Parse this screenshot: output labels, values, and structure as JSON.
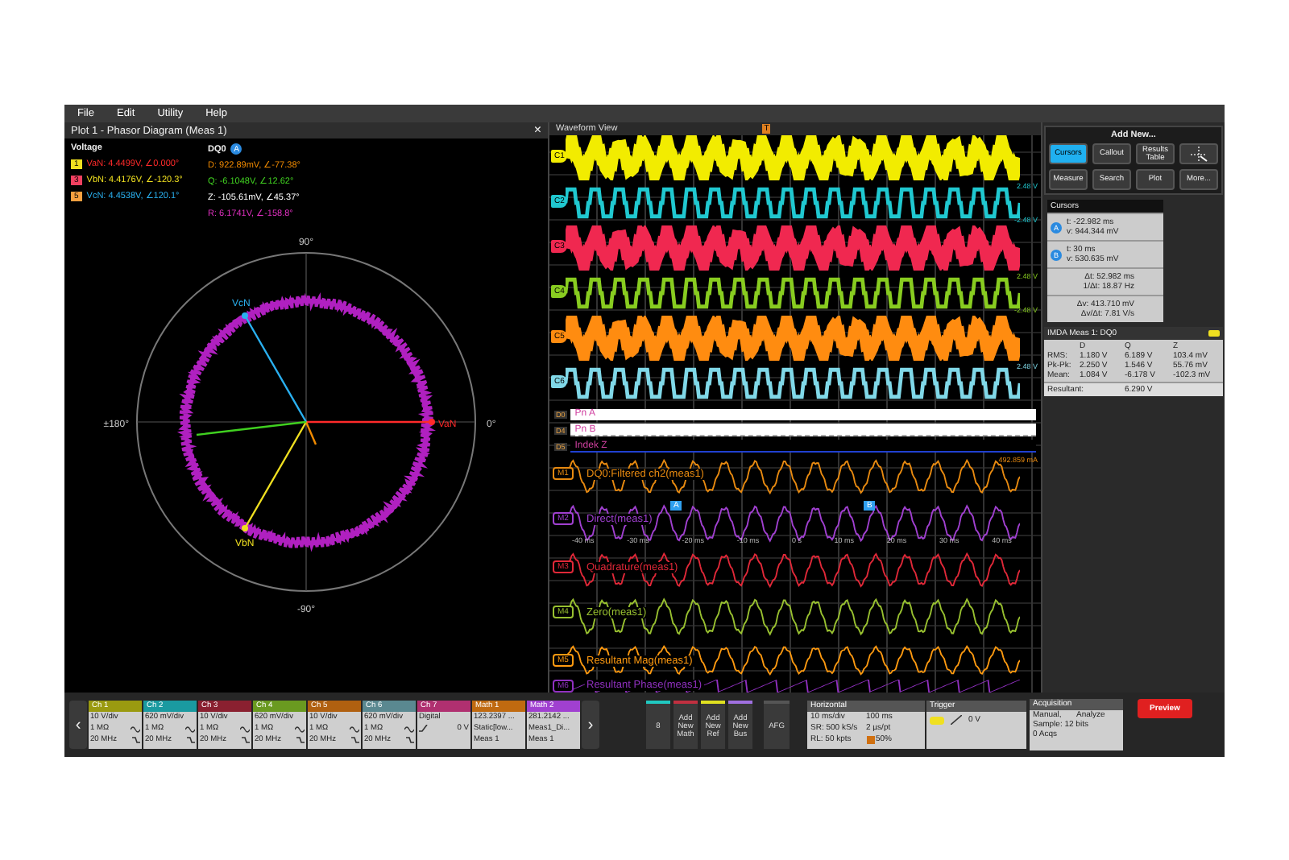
{
  "menu": [
    "File",
    "Edit",
    "Utility",
    "Help"
  ],
  "phasor": {
    "title": "Plot 1 - Phasor Diagram (Meas 1)",
    "close": "×",
    "voltage_heading": "Voltage",
    "dq0_heading": "DQ0",
    "dq0_badge": "A",
    "voltages": [
      {
        "badge": {
          "label": "1",
          "color": "#f0e020"
        },
        "text": "VaN: 4.4499V, ∠0.000°",
        "color": "#ff2a2a",
        "vector": "VaN"
      },
      {
        "badge": {
          "label": "3",
          "color": "#f04060"
        },
        "text": "VbN: 4.4176V, ∠-120.3°",
        "color": "#f0e020",
        "vector": "VbN"
      },
      {
        "badge": {
          "label": "5",
          "color": "#f7a040"
        },
        "text": "VcN: 4.4538V, ∠120.1°",
        "color": "#2ab0f0",
        "vector": "VcN"
      }
    ],
    "dq0": [
      {
        "text": "D: 922.89mV, ∠-77.38°",
        "color": "#f08a00"
      },
      {
        "text": "Q: -6.1048V, ∠12.62°",
        "color": "#40d020"
      },
      {
        "text": "Z: -105.61mV, ∠45.37°",
        "color": "#ffffff"
      },
      {
        "text": "R: 6.1741V, ∠-158.8°",
        "color": "#e030c0"
      }
    ],
    "axis_labels": [
      "90°",
      "0°",
      "±180°",
      "-90°"
    ]
  },
  "waveform": {
    "title": "Waveform View",
    "trigger": "T",
    "analog": [
      {
        "badge": "C1",
        "color": "#f2ec00",
        "kind": "pwm"
      },
      {
        "badge": "C2",
        "color": "#20c8d0",
        "kind": "step",
        "scale_top": "2.48 V",
        "scale_bottom": "-2.48 V"
      },
      {
        "badge": "C3",
        "color": "#f02850",
        "kind": "pwm"
      },
      {
        "badge": "C4",
        "color": "#88cc20",
        "kind": "step",
        "scale_top": "2.48 V",
        "scale_bottom": "-2.48 V"
      },
      {
        "badge": "C5",
        "color": "#ff8c10",
        "kind": "pwm"
      },
      {
        "badge": "C6",
        "color": "#80d8e8",
        "kind": "step",
        "scale_top": "2.48 V"
      }
    ],
    "digital": [
      {
        "badge": "D0",
        "label": "Pn A",
        "kind": "high"
      },
      {
        "badge": "D4",
        "label": "Pn B",
        "kind": "dashed"
      },
      {
        "badge": "D5",
        "label": "Indek Z",
        "kind": "ticks"
      }
    ],
    "math": [
      {
        "badge": "M1",
        "label": "DQ0:Filtered ch2(meas1)",
        "color": "#e88a10",
        "kind": "sine",
        "scale_top": "492.859 mA"
      },
      {
        "badge": "M2",
        "label": "Direct(meas1)",
        "color": "#a040d0",
        "kind": "sine",
        "cursors": [
          "A",
          "B"
        ],
        "time_ticks": [
          "-40 ms",
          "-30 ms",
          "-20 ms",
          "-10 ms",
          "0 s",
          "10 ms",
          "20 ms",
          "30 ms",
          "40 ms"
        ]
      },
      {
        "badge": "M3",
        "label": "Quadrature(meas1)",
        "color": "#e02838",
        "kind": "sine"
      },
      {
        "badge": "M4",
        "label": "Zero(meas1)",
        "color": "#98c030",
        "kind": "sine"
      },
      {
        "badge": "M5",
        "label": "Resultant Mag(meas1)",
        "color": "#ff9a10",
        "kind": "sine"
      },
      {
        "badge": "M6",
        "label": "Resultant Phase(meas1)",
        "color": "#9030c0",
        "kind": "saw"
      }
    ]
  },
  "add_new": {
    "title": "Add New...",
    "buttons": [
      {
        "kind": "text",
        "label": "Cursors",
        "selected": true
      },
      {
        "kind": "text",
        "label": "Callout",
        "selected": false
      },
      {
        "kind": "text",
        "label": "Results Table",
        "selected": false
      },
      {
        "kind": "icon",
        "selected": false
      },
      {
        "kind": "text",
        "label": "Measure",
        "selected": false
      },
      {
        "kind": "text",
        "label": "Search",
        "selected": false
      },
      {
        "kind": "text",
        "label": "Plot",
        "selected": false
      },
      {
        "kind": "text",
        "label": "More...",
        "selected": false
      }
    ]
  },
  "cursors": {
    "title": "Cursors",
    "groups": [
      {
        "marker": "A",
        "lines": [
          "t: -22.982 ms",
          "v: 944.344 mV"
        ]
      },
      {
        "marker": "B",
        "lines": [
          "t: 30 ms",
          "v: 530.635 mV"
        ]
      },
      {
        "lines": [
          "Δt: 52.982 ms",
          "1/Δt: 18.87 Hz"
        ]
      },
      {
        "lines": [
          "Δv: 413.710 mV",
          "Δv/Δt: 7.81 V/s"
        ]
      }
    ]
  },
  "measurement": {
    "title": "IMDA Meas 1: DQ0",
    "columns": [
      "D",
      "Q",
      "Z"
    ],
    "rows": [
      {
        "label": "RMS:",
        "values": [
          "1.180 V",
          "6.189 V",
          "103.4 mV"
        ]
      },
      {
        "label": "Pk-Pk:",
        "values": [
          "2.250 V",
          "1.546 V",
          "55.76 mV"
        ]
      },
      {
        "label": "Mean:",
        "values": [
          "1.084 V",
          "-6.178 V",
          "-102.3 mV"
        ]
      }
    ],
    "resultant": [
      "Resultant:",
      "6.290 V"
    ]
  },
  "channels": [
    {
      "name": "Ch 1",
      "color": "#9a9a10",
      "kind": "analog",
      "lines": [
        "10 V/div",
        "1 MΩ",
        "20 MHz"
      ]
    },
    {
      "name": "Ch 2",
      "color": "#1a9aa0",
      "kind": "analog",
      "lines": [
        "620 mV/div",
        "1 MΩ",
        "20 MHz"
      ]
    },
    {
      "name": "Ch 3",
      "color": "#8a2030",
      "kind": "analog",
      "lines": [
        "10 V/div",
        "1 MΩ",
        "20 MHz"
      ]
    },
    {
      "name": "Ch 4",
      "color": "#6a9a20",
      "kind": "analog",
      "lines": [
        "620 mV/div",
        "1 MΩ",
        "20 MHz"
      ]
    },
    {
      "name": "Ch 5",
      "color": "#b06010",
      "kind": "analog",
      "lines": [
        "10 V/div",
        "1 MΩ",
        "20 MHz"
      ]
    },
    {
      "name": "Ch 6",
      "color": "#5a8890",
      "kind": "analog",
      "lines": [
        "620 mV/div",
        "1 MΩ",
        "20 MHz"
      ]
    },
    {
      "name": "Ch 7",
      "color": "#b03070",
      "kind": "digital",
      "lines": [
        "Digital",
        "0 V"
      ]
    },
    {
      "name": "Math 1",
      "color": "#c06a10",
      "kind": "math",
      "lines": [
        "123.2397 ...",
        "Static[low...",
        "Meas 1"
      ]
    },
    {
      "name": "Math 2",
      "color": "#a040d0",
      "kind": "math",
      "lines": [
        "281.2142 ...",
        "Meas1_Di...",
        "Meas 1"
      ]
    }
  ],
  "nav": {
    "prev": "‹",
    "next": "›"
  },
  "tools": [
    {
      "label": "8",
      "color": "#20c8c0"
    },
    {
      "label": "Add New Math",
      "color": "#c03040"
    },
    {
      "label": "Add New Ref",
      "color": "#e0e020"
    },
    {
      "label": "Add New Bus",
      "color": "#a070e0"
    },
    {
      "label": "AFG",
      "color": "#555555"
    }
  ],
  "horizontal": {
    "title": "Horizontal",
    "cells": [
      "10 ms/div",
      "100 ms",
      "SR: 500 kS/s",
      "2 µs/pt",
      "RL: 50 kpts",
      "50%"
    ]
  },
  "trigger": {
    "title": "Trigger",
    "source": {
      "color": "#f0e020"
    },
    "value": "0 V"
  },
  "acquisition": {
    "title": "Acquisition",
    "cells": [
      "Manual,",
      "Analyze"
    ],
    "sample": "Sample: 12 bits",
    "last": "0 Acqs"
  },
  "preview": "Preview"
}
